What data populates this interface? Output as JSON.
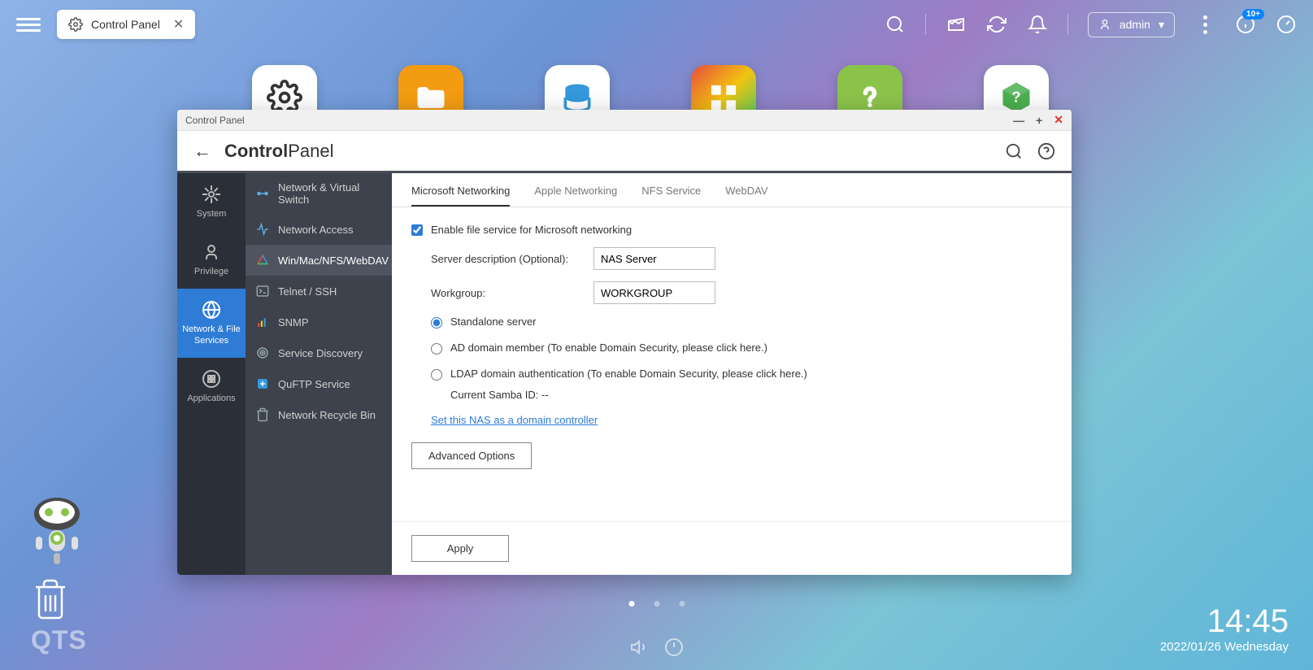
{
  "topbar": {
    "tab_title": "Control Panel",
    "user": "admin",
    "badge": "10+"
  },
  "window": {
    "title": "Control Panel",
    "heading_bold": "Control",
    "heading_light": "Panel"
  },
  "sidebar_l1": {
    "items": [
      {
        "label": "System"
      },
      {
        "label": "Privilege"
      },
      {
        "label": "Network & File Services"
      },
      {
        "label": "Applications"
      }
    ]
  },
  "sidebar_l2": {
    "items": [
      {
        "label": "Network & Virtual Switch"
      },
      {
        "label": "Network Access"
      },
      {
        "label": "Win/Mac/NFS/WebDAV"
      },
      {
        "label": "Telnet / SSH"
      },
      {
        "label": "SNMP"
      },
      {
        "label": "Service Discovery"
      },
      {
        "label": "QuFTP Service"
      },
      {
        "label": "Network Recycle Bin"
      }
    ]
  },
  "tabs": {
    "items": [
      {
        "label": "Microsoft Networking"
      },
      {
        "label": "Apple Networking"
      },
      {
        "label": "NFS Service"
      },
      {
        "label": "WebDAV"
      }
    ]
  },
  "form": {
    "enable_label": "Enable file service for Microsoft networking",
    "server_desc_label": "Server description (Optional):",
    "server_desc_value": "NAS Server",
    "workgroup_label": "Workgroup:",
    "workgroup_value": "WORKGROUP",
    "radio_standalone": "Standalone server",
    "radio_ad": "AD domain member (To enable Domain Security, please click here.)",
    "radio_ldap": "LDAP domain authentication (To enable Domain Security, please click here.)",
    "samba_id": "Current Samba ID: --",
    "domain_link": "Set this NAS as a domain controller",
    "advanced_btn": "Advanced Options",
    "apply_btn": "Apply"
  },
  "clock": {
    "time": "14:45",
    "date": "2022/01/26 Wednesday"
  },
  "logo": "QTS"
}
